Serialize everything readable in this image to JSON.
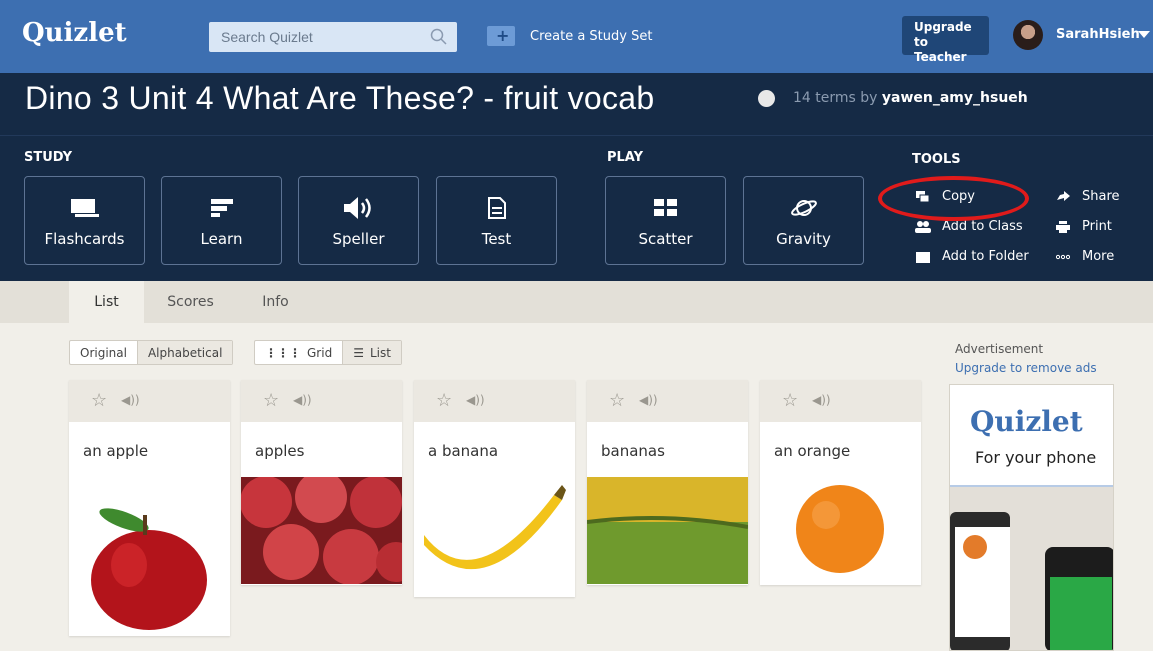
{
  "topbar": {
    "logo": "Quizlet",
    "search_placeholder": "Search Quizlet",
    "create_label": "Create a Study Set",
    "upgrade_line1": "Upgrade to",
    "upgrade_line2": "Teacher",
    "username": "SarahHsieh"
  },
  "set": {
    "title": "Dino 3 Unit 4 What Are These? - fruit vocab",
    "terms": "14 terms by ",
    "author": "yawen_amy_hsueh"
  },
  "sections": {
    "study": "STUDY",
    "play": "PLAY",
    "tools": "TOOLS"
  },
  "modes": {
    "flashcards": "Flashcards",
    "learn": "Learn",
    "speller": "Speller",
    "test": "Test",
    "scatter": "Scatter",
    "gravity": "Gravity"
  },
  "tools": {
    "copy": "Copy",
    "add_to_class": "Add to Class",
    "add_to_folder": "Add to Folder",
    "share": "Share",
    "print": "Print",
    "more": "More"
  },
  "tabs": [
    "List",
    "Scores",
    "Info"
  ],
  "sort": {
    "original": "Original",
    "alphabetical": "Alphabetical"
  },
  "view": {
    "grid": "Grid",
    "list": "List"
  },
  "cards": [
    "an apple",
    "apples",
    "a banana",
    "bananas",
    "an orange"
  ],
  "ad": {
    "label": "Advertisement",
    "link": "Upgrade to remove ads",
    "logo": "Quizlet",
    "tagline": "For your phone"
  },
  "colors": {
    "brand_blue": "#3d6fb1",
    "header_navy": "#152a45",
    "highlight_red": "#e01b1b"
  }
}
